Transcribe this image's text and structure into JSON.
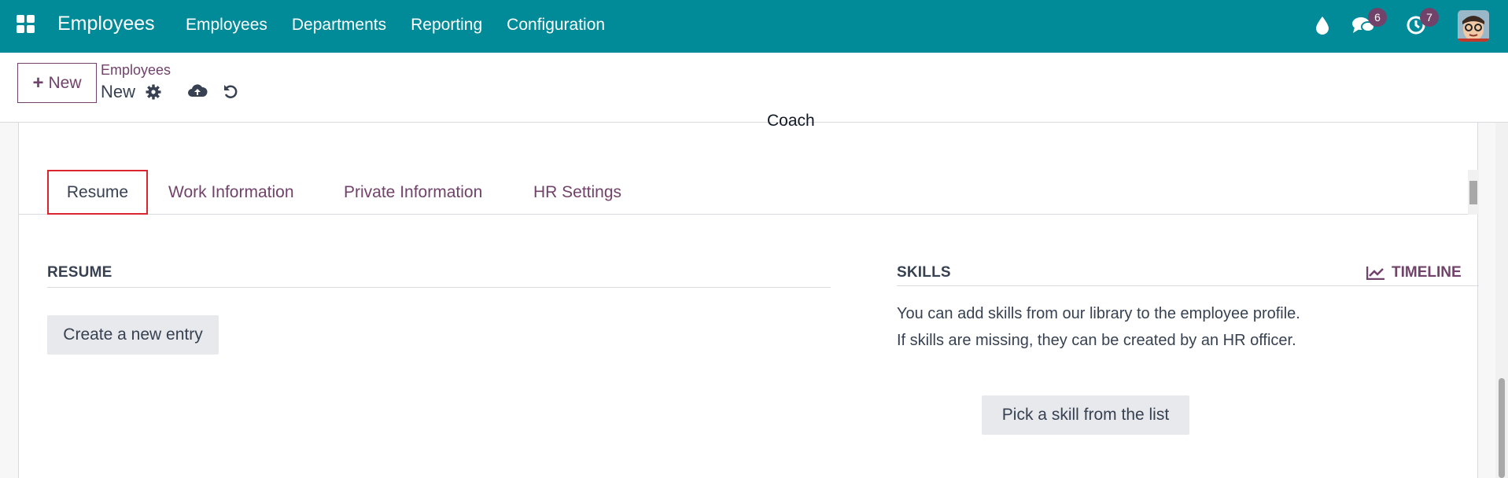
{
  "navbar": {
    "app_name": "Employees",
    "menu": [
      "Employees",
      "Departments",
      "Reporting",
      "Configuration"
    ],
    "activity_badge": "6",
    "clock_badge": "7",
    "icons": [
      "apps-icon",
      "drop-icon",
      "chat-icon",
      "clock-icon",
      "avatar"
    ]
  },
  "control_panel": {
    "new_label": "New",
    "breadcrumb": "Employees",
    "record_name": "New",
    "icons": [
      "gear-icon",
      "cloud-upload-icon",
      "undo-icon"
    ]
  },
  "form": {
    "coach_label": "Coach",
    "tabs": [
      "Resume",
      "Work Information",
      "Private Information",
      "HR Settings"
    ],
    "active_tab": "Resume",
    "resume": {
      "title": "RESUME",
      "create_label": "Create a new entry"
    },
    "skills": {
      "title": "SKILLS",
      "timeline_label": "TIMELINE",
      "help_line1": "You can add skills from our library to the employee profile.",
      "help_line2": "If skills are missing, they can be created by an HR officer.",
      "pick_label": "Pick a skill from the list"
    }
  },
  "colors": {
    "navbar": "#018a98",
    "primary": "#71426a",
    "tab_highlight": "#d9262e"
  }
}
